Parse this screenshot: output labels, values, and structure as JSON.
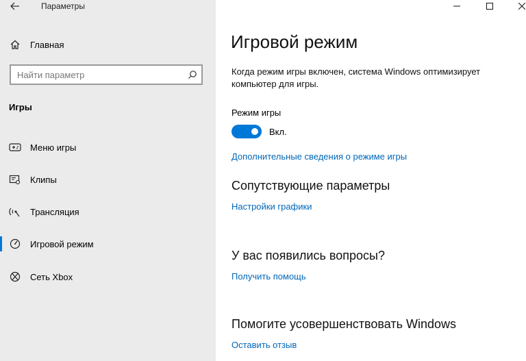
{
  "window": {
    "title": "Параметры",
    "controls": {
      "minimize": "—",
      "maximize": "☐",
      "close": "✕"
    }
  },
  "sidebar": {
    "home_label": "Главная",
    "search_placeholder": "Найти параметр",
    "section_title": "Игры",
    "items": [
      {
        "label": "Меню игры",
        "icon": "game-bar-icon"
      },
      {
        "label": "Клипы",
        "icon": "clips-icon"
      },
      {
        "label": "Трансляция",
        "icon": "broadcast-icon"
      },
      {
        "label": "Игровой режим",
        "icon": "game-mode-icon",
        "active": true
      },
      {
        "label": "Сеть Xbox",
        "icon": "xbox-icon"
      }
    ]
  },
  "main": {
    "title": "Игровой режим",
    "description": "Когда режим игры включен, система Windows оптимизирует компьютер для игры.",
    "toggle": {
      "label": "Режим игры",
      "state": "Вкл.",
      "on": true
    },
    "more_info_link": "Дополнительные сведения о режиме игры",
    "related": {
      "heading": "Сопутствующие параметры",
      "link": "Настройки графики"
    },
    "questions": {
      "heading": "У вас появились вопросы?",
      "link": "Получить помощь"
    },
    "improve": {
      "heading": "Помогите усовершенствовать Windows",
      "link": "Оставить отзыв"
    }
  },
  "colors": {
    "accent": "#0078d7",
    "link": "#0067b8",
    "sidebar_bg": "#ebebeb"
  }
}
